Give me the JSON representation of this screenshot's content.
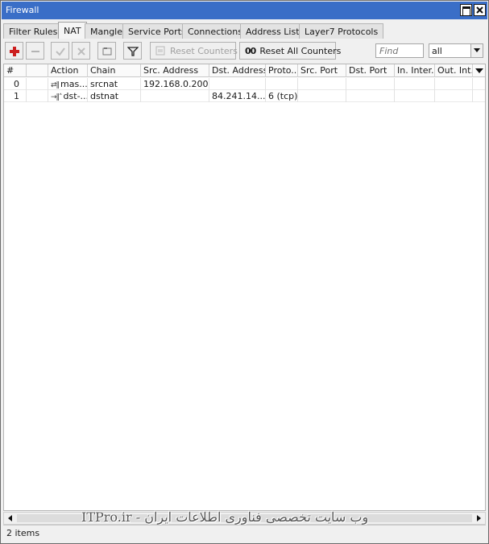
{
  "window": {
    "title": "Firewall"
  },
  "tabs": [
    {
      "label": "Filter Rules"
    },
    {
      "label": "NAT"
    },
    {
      "label": "Mangle"
    },
    {
      "label": "Service Ports"
    },
    {
      "label": "Connections"
    },
    {
      "label": "Address Lists"
    },
    {
      "label": "Layer7 Protocols"
    }
  ],
  "active_tab": "NAT",
  "toolbar": {
    "reset_counters": "Reset Counters",
    "reset_all_prefix": "00",
    "reset_all_counters": "Reset All Counters",
    "find_placeholder": "Find",
    "filter_value": "all"
  },
  "icons": {
    "add": "plus-icon",
    "remove": "minus-icon",
    "enable": "check-icon",
    "disable": "x-icon",
    "comment": "comment-icon",
    "filter": "funnel-icon"
  },
  "colors": {
    "titlebar": "#3a6ec7",
    "add_icon": "#cc1f1f"
  },
  "table": {
    "columns": [
      "#",
      "",
      "Action",
      "Chain",
      "Src. Address",
      "Dst. Address",
      "Proto...",
      "Src. Port",
      "Dst. Port",
      "In. Inter...",
      "Out. Int..."
    ],
    "rows": [
      {
        "num": "0",
        "action_icon": "⇄‖",
        "action": "mas...",
        "chain": "srcnat",
        "src": "192.168.0.200",
        "dst": "",
        "proto": "",
        "sport": "",
        "dport": "",
        "inif": "",
        "outif": ""
      },
      {
        "num": "1",
        "action_icon": "→‖˄",
        "action": "dst-...",
        "chain": "dstnat",
        "src": "",
        "dst": "84.241.14....",
        "proto": "6 (tcp)",
        "sport": "",
        "dport": "",
        "inif": "",
        "outif": ""
      }
    ]
  },
  "watermark": "وب سایت تخصصی فناوری اطلاعات ایران - ITPro.ir",
  "status": {
    "text": "2 items"
  }
}
